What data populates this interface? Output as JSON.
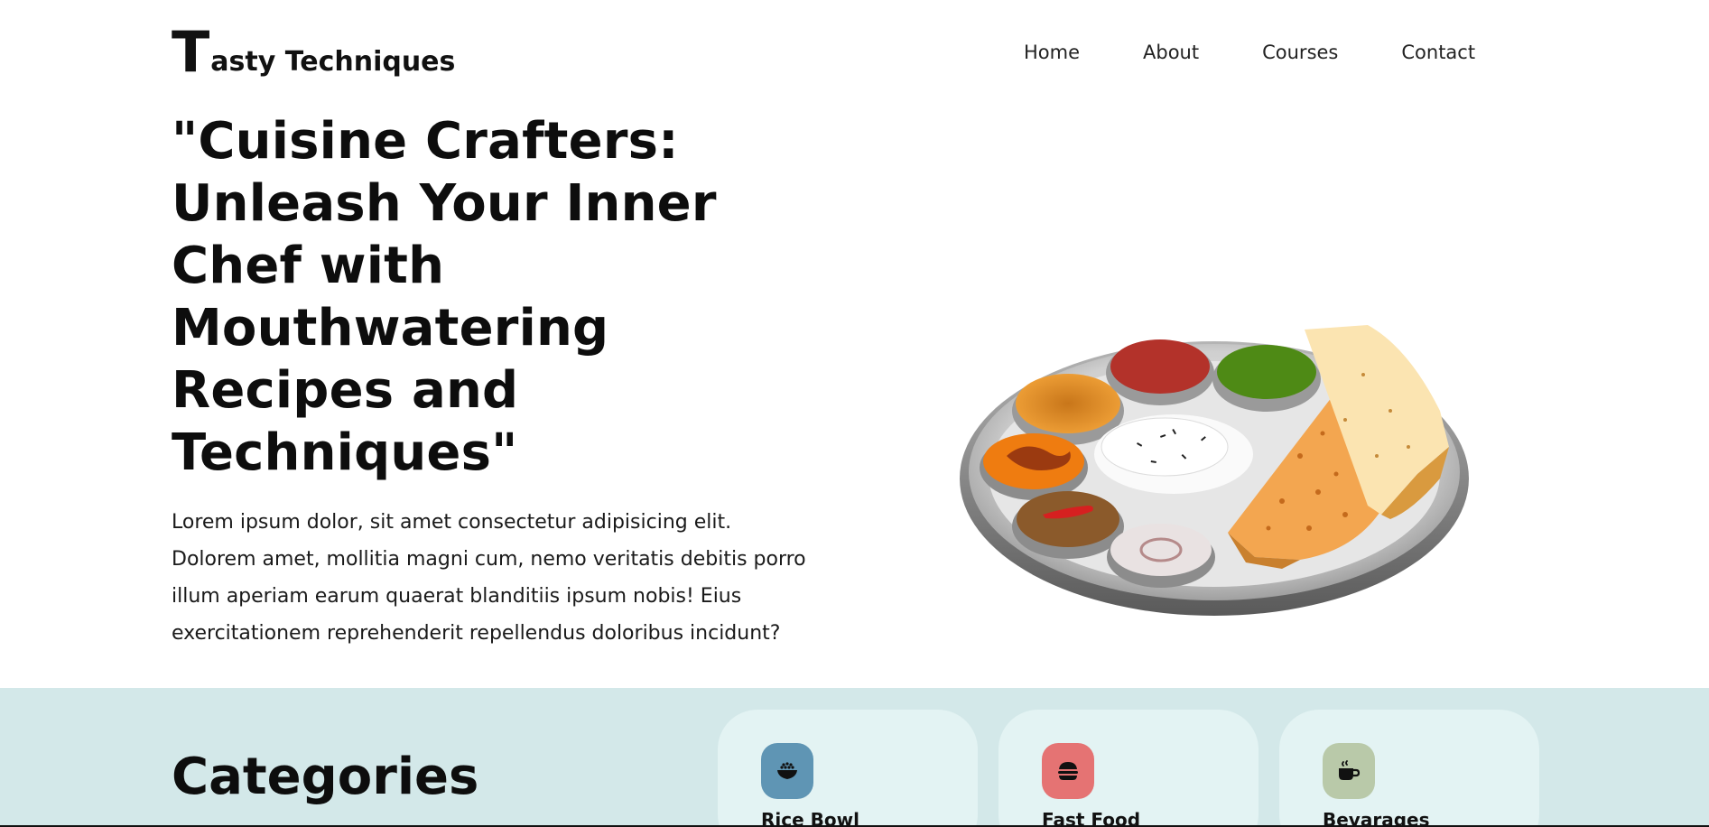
{
  "header": {
    "logo_initial": "T",
    "logo_rest": "asty Techniques",
    "nav": [
      {
        "label": "Home"
      },
      {
        "label": "About"
      },
      {
        "label": "Courses"
      },
      {
        "label": "Contact"
      }
    ]
  },
  "hero": {
    "title": "\"Cuisine Crafters: Unleash Your Inner Chef with Mouthwatering Recipes and Techniques\"",
    "text": "Lorem ipsum dolor, sit amet consectetur adipisicing elit. Dolorem amet, mollitia magni cum, nemo veritatis debitis porro illum aperiam earum quaerat blanditiis ipsum nobis! Eius exercitationem reprehenderit repellendus doloribus incidunt?",
    "image_icon": "thali-plate-illustration"
  },
  "categories": {
    "title": "Categories",
    "items": [
      {
        "label": "Rice Bowl",
        "icon": "rice-bowl-icon",
        "color": "#5f95b4"
      },
      {
        "label": "Fast Food",
        "icon": "burger-icon",
        "color": "#e57373"
      },
      {
        "label": "Bevarages",
        "icon": "coffee-cup-icon",
        "color": "#b9c9a9"
      }
    ]
  },
  "colors": {
    "section_bg": "#d3e8e9",
    "card_bg": "#e3f3f3"
  }
}
